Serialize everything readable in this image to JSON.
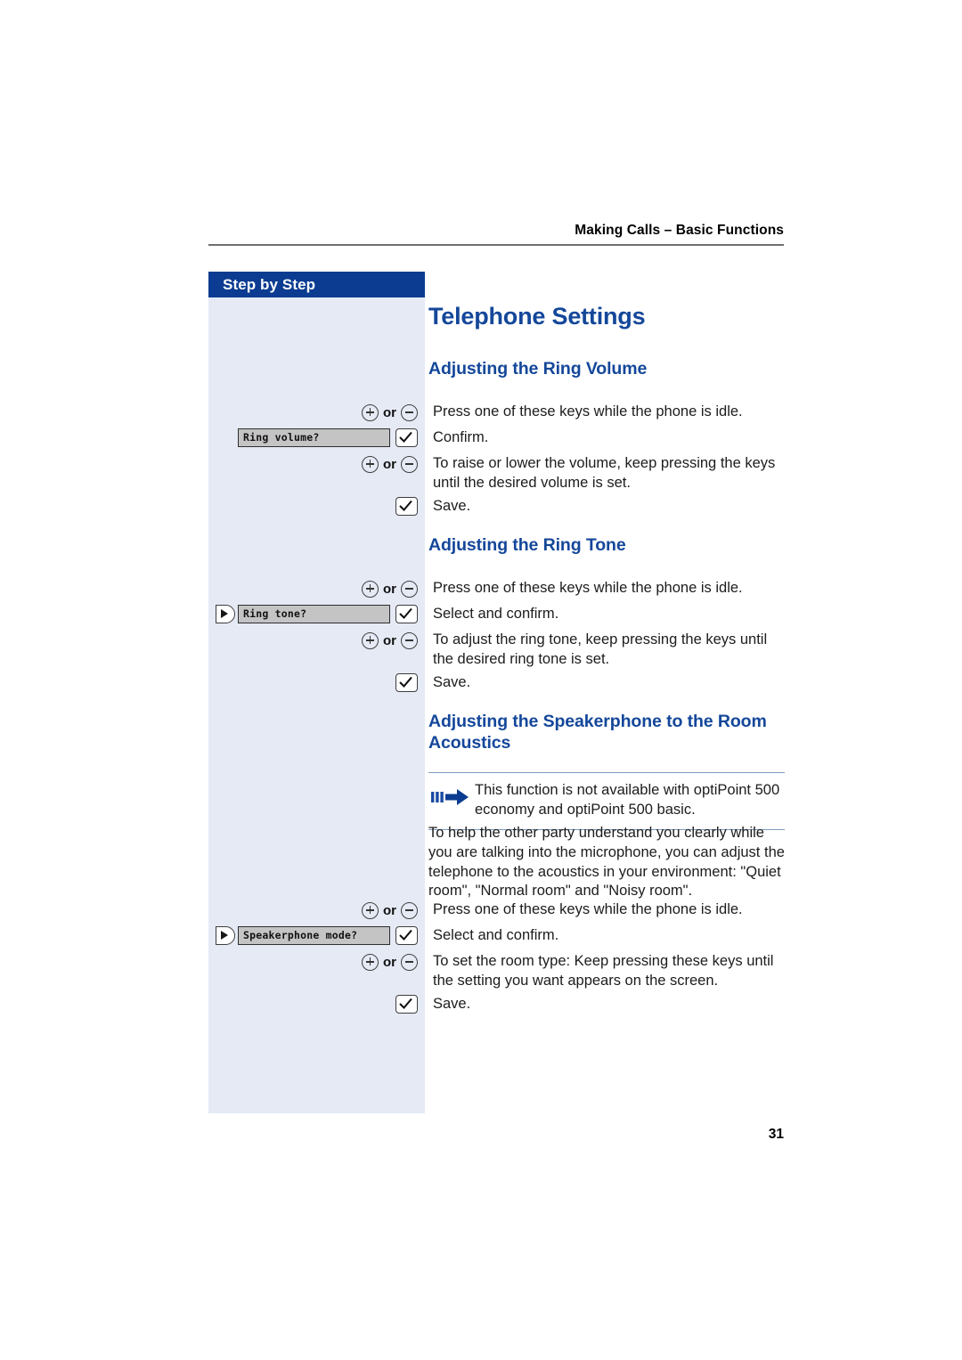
{
  "header": {
    "running_head": "Making Calls – Basic Functions",
    "rule_color": "#6f6f6f"
  },
  "sidebar": {
    "title": "Step by Step",
    "header_bg": "#0b3c91",
    "body_bg": "#e5eaf5"
  },
  "page": {
    "number": "31",
    "heading_color": "#14479a"
  },
  "titles": {
    "doc_title": "Telephone Settings",
    "section_ring_volume": "Adjusting the Ring Volume",
    "section_ring_tone": "Adjusting the Ring Tone",
    "section_speakerphone": "Adjusting the Speakerphone to the Room Acoustics"
  },
  "icons": {
    "plus_key": "plus-key-icon",
    "minus_key": "minus-key-icon",
    "or": "or",
    "checkmark_key": "checkmark-key-icon",
    "navigator_key": "navigator-right-icon",
    "note_arrow": "blue-arrow-icon"
  },
  "ring_volume": {
    "steps": [
      {
        "key": "plus-or-minus",
        "text": "Press one of these keys while the phone is idle."
      },
      {
        "key": "display-and-check",
        "display": "Ring volume?",
        "text": "Confirm."
      },
      {
        "key": "plus-or-minus",
        "text": "To raise or lower the volume, keep pressing the keys until the desired volume is set."
      },
      {
        "key": "check",
        "text": "Save."
      }
    ]
  },
  "ring_tone": {
    "steps": [
      {
        "key": "plus-or-minus",
        "text": "Press one of these keys while the phone is idle."
      },
      {
        "key": "nav-display-and-check",
        "display": "Ring tone?",
        "text": "Select and confirm."
      },
      {
        "key": "plus-or-minus",
        "text": "To adjust the ring tone, keep pressing the keys until the desired ring tone is set."
      },
      {
        "key": "check",
        "text": "Save."
      }
    ]
  },
  "speakerphone": {
    "note": "This function is not available with optiPoint 500 economy and optiPoint 500 basic.",
    "intro": "To help the other party understand you clearly while you are talking into the microphone, you can adjust the telephone to the acoustics in your environment: \"Quiet room\", \"Normal room\"  and \"Noisy room\".",
    "steps": [
      {
        "key": "plus-or-minus",
        "text": "Press one of these keys while the phone is idle."
      },
      {
        "key": "nav-display-and-check",
        "display": "Speakerphone mode?",
        "text": "Select and confirm."
      },
      {
        "key": "plus-or-minus",
        "text": "To set the room type: Keep pressing these keys until the setting you want appears on the screen."
      },
      {
        "key": "check",
        "text": "Save."
      }
    ]
  }
}
